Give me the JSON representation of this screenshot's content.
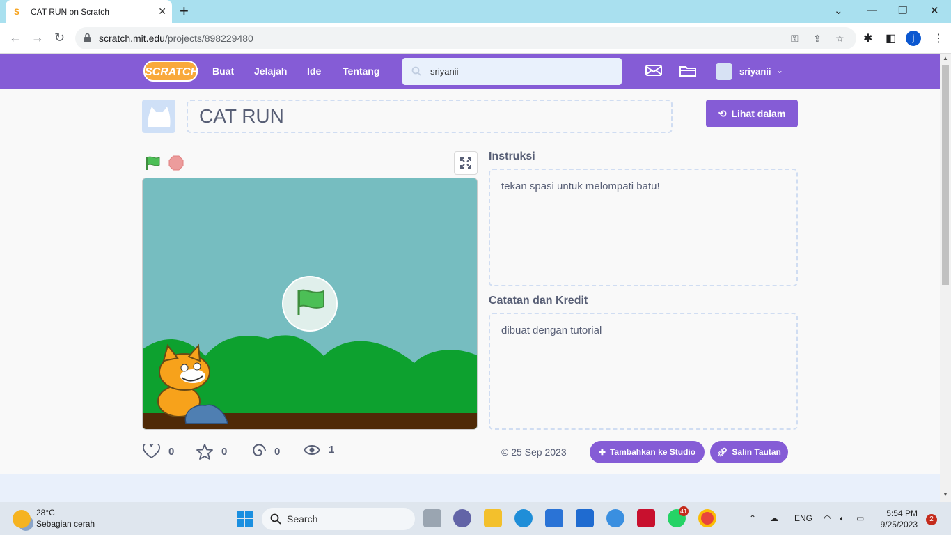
{
  "browser": {
    "tab_title": "CAT RUN on Scratch",
    "tab_favicon": "S",
    "new_tab": "+",
    "url_host": "scratch.mit.edu",
    "url_path": "/projects/898229480",
    "profile_initial": "j"
  },
  "scratch_nav": {
    "logo": "SCRATCH",
    "links": [
      "Buat",
      "Jelajah",
      "Ide",
      "Tentang"
    ],
    "search_value": "sriyanii",
    "username": "sriyanii",
    "accent_color": "#855cd6"
  },
  "project": {
    "title": "CAT RUN",
    "see_inside_label": "Lihat dalam",
    "instructions_heading": "Instruksi",
    "instructions_text": "tekan spasi untuk melompati batu!",
    "notes_heading": "Catatan dan Kredit",
    "notes_text": "dibuat dengan tutorial",
    "stats": {
      "loves": "0",
      "favorites": "0",
      "remixes": "0",
      "views": "1"
    },
    "date": "25 Sep 2023",
    "add_to_studio_label": "Tambahkan ke Studio",
    "copy_link_label": "Salin Tautan"
  },
  "taskbar": {
    "temperature": "28°C",
    "weather": "Sebagian cerah",
    "search_placeholder": "Search",
    "whatsapp_badge": "41",
    "language": "ENG",
    "time": "5:54 PM",
    "date": "9/25/2023",
    "notifications": "2"
  }
}
